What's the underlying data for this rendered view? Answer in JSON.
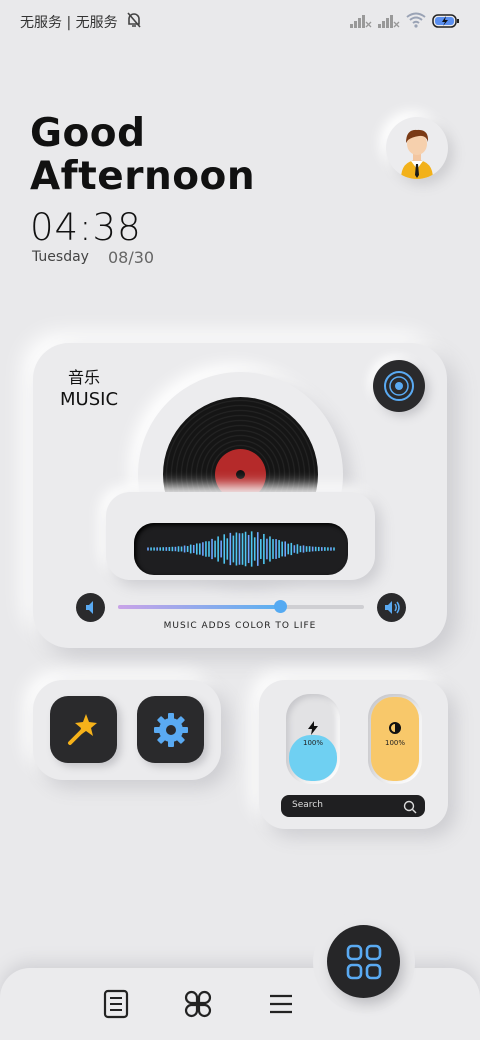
{
  "status_bar": {
    "carrier": "无服务 | 无服务",
    "icons": [
      "mute-bell-icon",
      "signal-icon",
      "signal-icon",
      "wifi-icon",
      "battery-charging-icon"
    ]
  },
  "greeting": {
    "line1": "Good",
    "line2": "Afternoon",
    "time": "04:38",
    "day": "Tuesday",
    "date": "08/30"
  },
  "music": {
    "title_cn": "音乐",
    "title_en": "MUSIC",
    "slogan": "MUSIC ADDS COLOR TO LIFE",
    "volume_level": 0.66,
    "accent": "#55aaf2",
    "record_label_color": "#b52a2a"
  },
  "tools": {
    "items": [
      "magic-wand-icon",
      "gear-icon"
    ],
    "wand_color": "#f6b21a",
    "gear_color": "#5aaaf2"
  },
  "controls": {
    "power": {
      "icon": "lightning-icon",
      "percent": "100%",
      "color": "#6fd0f2",
      "level": 1.0
    },
    "brightness": {
      "icon": "brightness-icon",
      "percent": "100%",
      "color": "#f8c86a",
      "level": 1.0
    },
    "search_placeholder": "Search"
  },
  "nav": {
    "items": [
      "document-icon",
      "clover-icon",
      "menu-icon"
    ],
    "fab_icon": "apps-grid-icon",
    "fab_color": "#5aaaf2"
  }
}
